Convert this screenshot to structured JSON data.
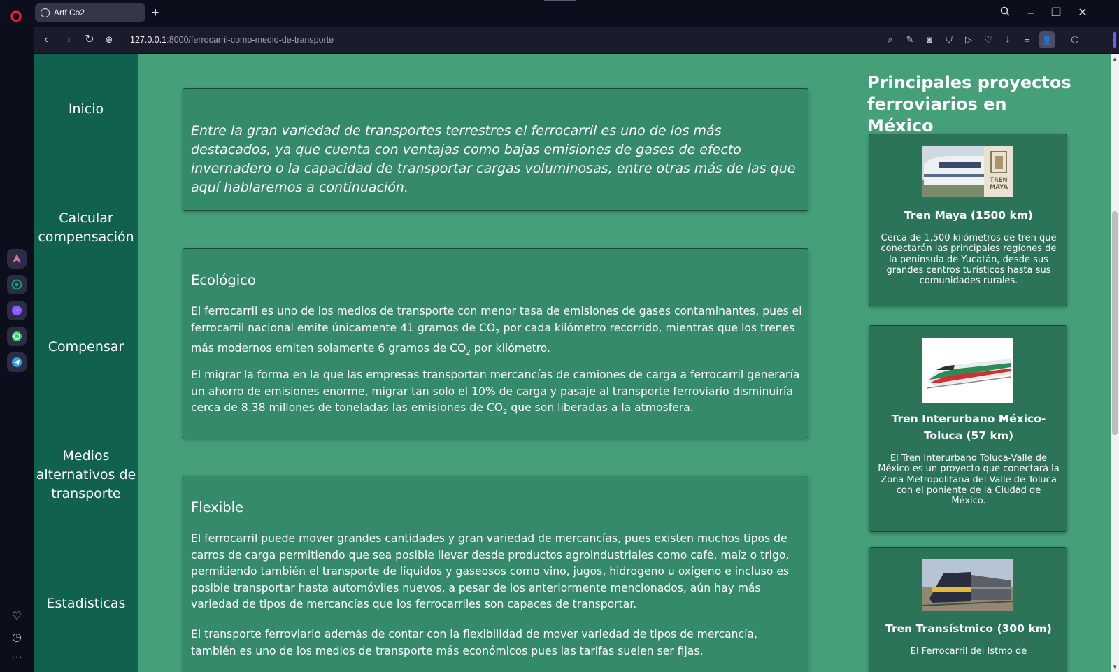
{
  "browser": {
    "tab_title": "Artf Co2",
    "new_tab_symbol": "+",
    "url_host": "127.0.0.1",
    "url_path": ":8000/ferrocarril-como-medio-de-transporte"
  },
  "nav": {
    "items": [
      {
        "label": "Inicio"
      },
      {
        "label": "Calcular compensación"
      },
      {
        "label": "Compensar"
      },
      {
        "label": "Medios alternativos de transporte"
      },
      {
        "label": "Estadisticas"
      }
    ]
  },
  "intro": {
    "text": "Entre la gran variedad de transportes terrestres el ferrocarril es uno de los más destacados, ya que cuenta con ventajas como bajas emisiones de gases de efecto invernadero o la capacidad de transportar cargas voluminosas, entre otras más de las que aquí hablaremos a continuación."
  },
  "ecologico": {
    "title": "Ecológico",
    "p1_a": "El ferrocarril es uno de los medios de transporte con menor tasa de emisiones de gases contaminantes, pues el ferrocarril nacional emite únicamente 41 gramos de CO",
    "p1_b": " por cada kilómetro recorrido, mientras que los trenes más modernos emiten solamente 6 gramos de CO",
    "p1_c": " por kilómetro.",
    "p2_a": "El migrar la forma en la que las empresas transportan mercancías de camiones de carga a ferrocarril generaría un ahorro de emisiones enorme, migrar tan solo el 10% de carga y pasaje al transporte ferroviario disminuiría cerca de 8.38 millones de toneladas las emisiones de CO",
    "p2_b": " que son liberadas a la atmosfera.",
    "sub": "2"
  },
  "flexible": {
    "title": "Flexible",
    "p1": "El ferrocarril puede mover grandes cantidades y gran variedad de mercancías, pues existen muchos tipos de carros de carga permitiendo que sea posible llevar desde productos agroindustriales como café, maíz o trigo, permitiendo también el transporte de líquidos y gaseosos como vino, jugos, hidrogeno u oxígeno e incluso es posible transportar hasta automóviles nuevos, a pesar de los anteriormente mencionados, aún hay más variedad de tipos de mercancías que los ferrocarriles son capaces de transportar.",
    "p2": "El transporte ferroviario además de contar con la flexibilidad de mover variedad de tipos de mercancía, también es uno de los medios de transporte más económicos pues las tarifas suelen ser fijas."
  },
  "aside": {
    "title": "Principales proyectos ferroviarios en México",
    "projects": [
      {
        "title": "Tren Maya (1500 km)",
        "logo_text": "TREN MAYA",
        "desc": "Cerca de 1,500 kilómetros de tren que conectarán las principales regiones de la península de Yucatán, desde sus grandes centros turísticos hasta sus comunidades rurales."
      },
      {
        "title": "Tren Interurbano México-Toluca (57 km)",
        "desc": "El Tren Interurbano Toluca-Valle de México es un proyecto que conectará la Zona Metropolitana del Valle de Toluca con el poniente de la Ciudad de México."
      },
      {
        "title": "Tren Transístmico (300 km)",
        "desc": "El Ferrocarril del Istmo de"
      }
    ]
  },
  "colors": {
    "page_bg": "#45a07a",
    "nav_bg": "#10614f",
    "card_bg": "#358a69",
    "project_bg": "#2b7457"
  }
}
